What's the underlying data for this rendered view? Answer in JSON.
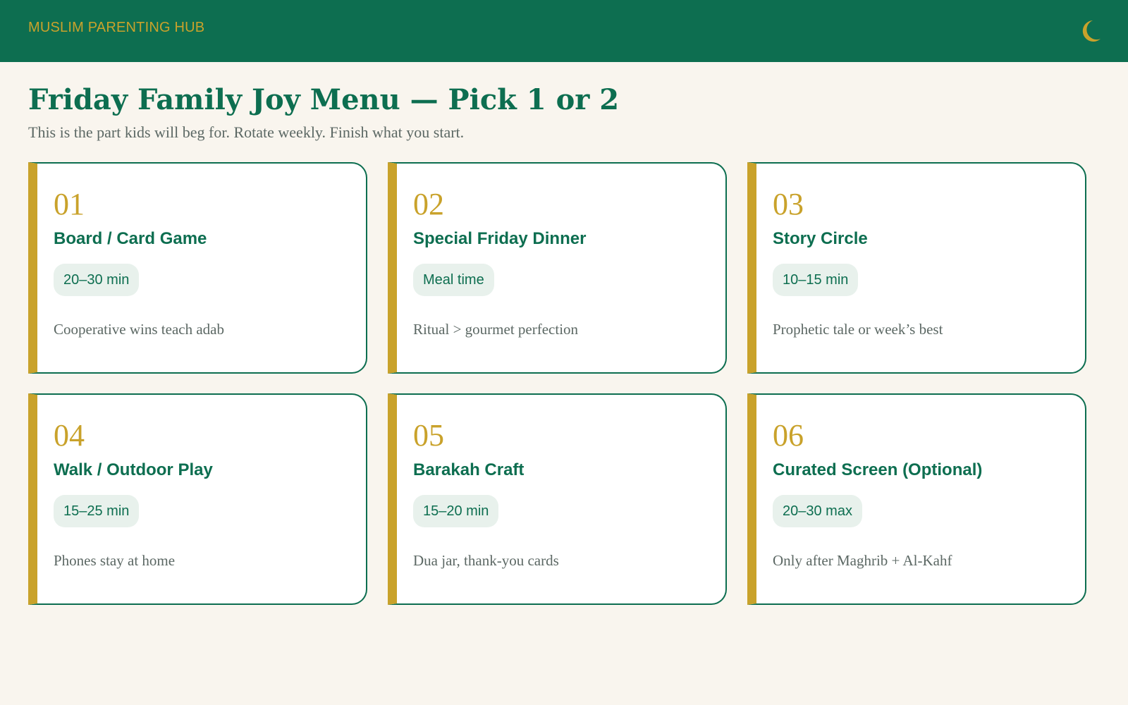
{
  "header": {
    "brand": "MUSLIM PARENTING HUB",
    "icon": "crescent-moon-icon",
    "background_color": "#0d6e50",
    "accent_color": "#c9a22b"
  },
  "page": {
    "title": "Friday Family Joy Menu — Pick 1 or 2",
    "subtitle": "This is the part kids will beg for. Rotate weekly. Finish what you start."
  },
  "cards": [
    {
      "number": "01",
      "title": "Board / Card Game",
      "tag": "20–30 min",
      "description": "Cooperative wins teach adab"
    },
    {
      "number": "02",
      "title": "Special Friday Dinner",
      "tag": "Meal time",
      "description": "Ritual > gourmet perfection"
    },
    {
      "number": "03",
      "title": "Story Circle",
      "tag": "10–15 min",
      "description": "Prophetic tale or week’s best"
    },
    {
      "number": "04",
      "title": "Walk / Outdoor Play",
      "tag": "15–25 min",
      "description": "Phones stay at home"
    },
    {
      "number": "05",
      "title": "Barakah Craft",
      "tag": "15–20 min",
      "description": "Dua jar, thank-you cards"
    },
    {
      "number": "06",
      "title": "Curated Screen (Optional)",
      "tag": "20–30 max",
      "description": "Only after Maghrib + Al-Kahf"
    }
  ]
}
